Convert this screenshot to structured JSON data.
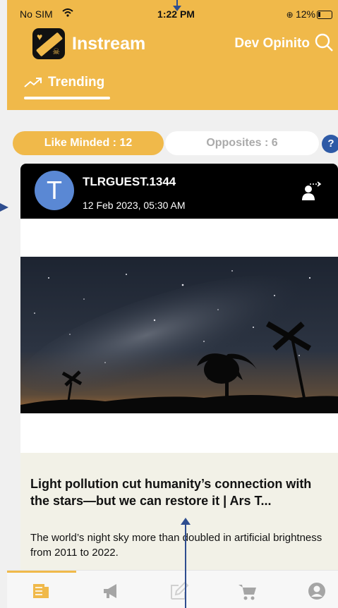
{
  "status_bar": {
    "carrier": "No SIM",
    "time": "1:22 PM",
    "battery": "12%"
  },
  "header": {
    "app_title": "Instream",
    "user_name": "Dev Opinito",
    "logo_text": "OPINITO"
  },
  "tabs": [
    {
      "label": "Trending",
      "icon": "trending-up-icon",
      "active": true
    }
  ],
  "filters": {
    "like_minded": "Like Minded : 12",
    "opposites": "Opposites : 6",
    "help": "?"
  },
  "post": {
    "avatar_letter": "T",
    "username": "TLRGUEST.1344",
    "date": "12 Feb 2023, 05:30 AM",
    "image": "night-sky-milky-way-photo",
    "link_title": "Light pollution cut humanity’s connection with the stars—but we can restore it | Ars T...",
    "link_description": "The world’s night sky more than doubled in artificial brightness from 2011 to 2022."
  },
  "bottom_nav": [
    {
      "icon": "feed-icon",
      "active": true
    },
    {
      "icon": "megaphone-icon",
      "active": false
    },
    {
      "icon": "edit-icon",
      "active": false
    },
    {
      "icon": "cart-icon",
      "active": false
    },
    {
      "icon": "profile-icon",
      "active": false
    }
  ],
  "colors": {
    "accent": "#f0b94a",
    "header_text": "#ffffff",
    "help_blue": "#2e5aa6",
    "avatar_blue": "#5a88d4",
    "preview_bg": "#f2f1e7"
  }
}
